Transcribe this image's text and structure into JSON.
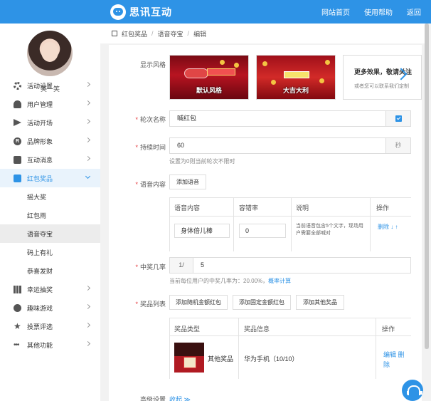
{
  "app": {
    "name": "思讯互动",
    "accent": "#2e93e6"
  },
  "topnav": [
    "网站首页",
    "使用帮助",
    "返回"
  ],
  "user": {
    "name": "笑一笑"
  },
  "sidebar": {
    "items": [
      {
        "label": "活动设置",
        "icon": "gear-icon"
      },
      {
        "label": "用户管理",
        "icon": "user-icon"
      },
      {
        "label": "活动开场",
        "icon": "send-icon"
      },
      {
        "label": "品牌形象",
        "icon": "brand-r-icon"
      },
      {
        "label": "互动消息",
        "icon": "message-icon"
      },
      {
        "label": "红包奖品",
        "icon": "red-envelope-icon"
      },
      {
        "label": "幸运抽奖",
        "icon": "bar-chart-icon"
      },
      {
        "label": "趣味游戏",
        "icon": "game-icon"
      },
      {
        "label": "投票评选",
        "icon": "star-icon"
      },
      {
        "label": "其他功能",
        "icon": "more-dots-icon"
      }
    ],
    "sub_items": [
      "摇大奖",
      "红包雨",
      "语音夺宝",
      "码上有礼",
      "恭喜发财"
    ]
  },
  "breadcrumb": [
    "红包奖品",
    "语音夺宝",
    "编辑"
  ],
  "form": {
    "style_label": "显示风格",
    "styles": [
      "默认风格",
      "大吉大利"
    ],
    "more_title": "更多效果，敬请关注",
    "more_sub": "或者您可以联系我们定制",
    "round_label": "轮次名称",
    "round_value": "喊红包",
    "duration_label": "持续时间",
    "duration_value": "60",
    "duration_unit": "秒",
    "duration_hint": "设置为0则当前轮次不限时",
    "voice_label": "语音内容",
    "add_voice": "添加语音",
    "voice_table": {
      "headers": [
        "语音内容",
        "容错率",
        "说明",
        "操作"
      ],
      "rows": [
        {
          "content": "身体倍儿棒",
          "tolerance": "0",
          "desc": "当前语音包含5个文字，现场用户需要全部喊对",
          "actions": "删除 ↓ ↑"
        }
      ]
    },
    "rate_label": "中奖几率",
    "rate_prefix": "1/",
    "rate_value": "5",
    "rate_hint": "当前每位用户的中奖几率为：20.00%，",
    "rate_link": "概率计算",
    "prize_label": "奖品列表",
    "prize_buttons": [
      "添加随机金额红包",
      "添加固定金额红包",
      "添加其他奖品"
    ],
    "prize_table": {
      "headers": [
        "奖品类型",
        "奖品信息",
        "操作"
      ],
      "rows": [
        {
          "type": "其他奖品",
          "info": "华为手机（10/10）",
          "edit": "编辑",
          "delete_1": "删",
          "delete_2": "除"
        }
      ]
    },
    "advanced_label": "高级设置",
    "collapse": "收起 ≫"
  }
}
